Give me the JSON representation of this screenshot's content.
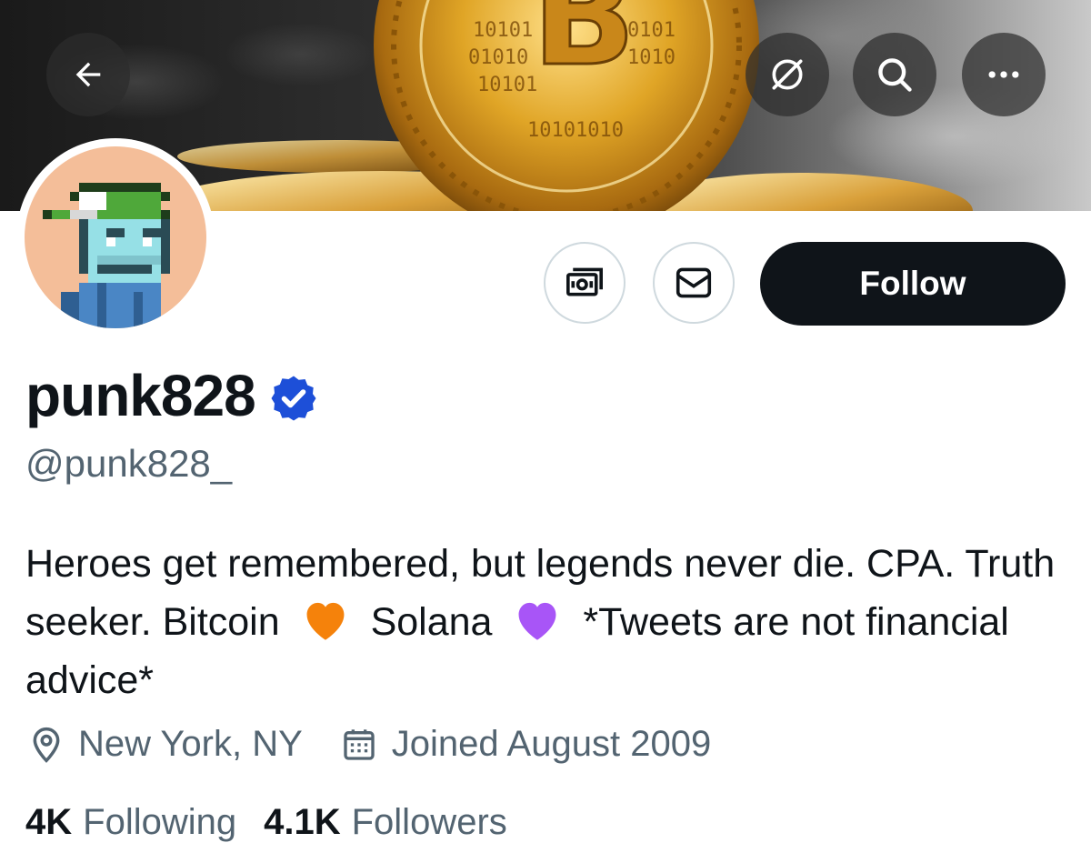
{
  "banner": {
    "description_icon": "bitcoin-coin-image"
  },
  "top_bar": {
    "back_icon": "arrow-left-icon",
    "grok_icon": "slash-circle-icon",
    "search_icon": "search-icon",
    "more_icon": "more-horizontal-icon"
  },
  "actions": {
    "tip_icon": "money-icon",
    "message_icon": "envelope-icon",
    "follow_label": "Follow"
  },
  "profile": {
    "display_name": "punk828",
    "handle": "@punk828_",
    "bio_part1": "Heroes get remembered, but legends never die. CPA. Truth seeker. Bitcoin",
    "bio_part2": "Solana",
    "bio_part3": "*Tweets are not financial advice*",
    "location": "New York, NY",
    "joined": "Joined August 2009"
  },
  "stats": {
    "following_count": "4K",
    "following_label": "Following",
    "followers_count": "4.1K",
    "followers_label": "Followers"
  },
  "colors": {
    "text_primary": "#0f1419",
    "text_secondary": "#536471",
    "verified_blue": "#1d4fd8",
    "orange_heart": "#f5820b",
    "purple_heart": "#a855f7"
  }
}
